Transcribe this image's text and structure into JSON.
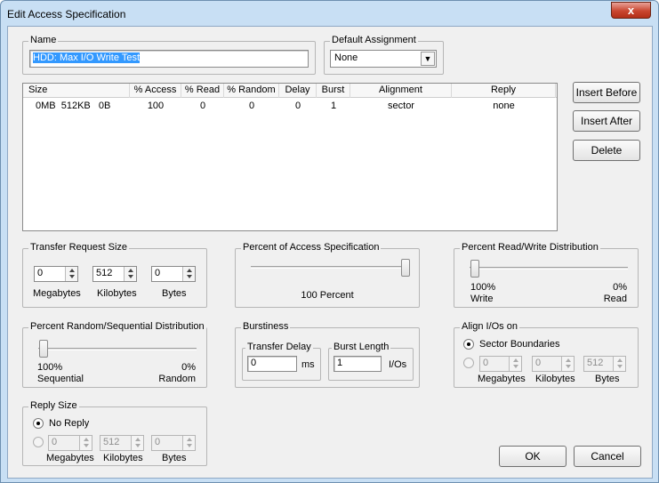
{
  "window": {
    "title": "Edit Access Specification",
    "close_symbol": "x"
  },
  "name_group": {
    "label": "Name",
    "value": "HDD: Max I/O Write Test"
  },
  "default_assignment": {
    "label": "Default Assignment",
    "value": "None"
  },
  "list": {
    "columns": [
      "Size",
      "% Access",
      "% Read",
      "% Random",
      "Delay",
      "Burst",
      "Alignment",
      "Reply"
    ],
    "rows": [
      {
        "size": "0MB  512KB   0B",
        "access": "100",
        "read": "0",
        "random": "0",
        "delay": "0",
        "burst": "1",
        "alignment": "sector",
        "reply": "none"
      }
    ]
  },
  "buttons": {
    "insert_before": "Insert Before",
    "insert_after": "Insert After",
    "delete": "Delete",
    "ok": "OK",
    "cancel": "Cancel"
  },
  "transfer_request": {
    "label": "Transfer Request Size",
    "megabytes": "0",
    "kilobytes": "512",
    "bytes": "0",
    "mb_label": "Megabytes",
    "kb_label": "Kilobytes",
    "b_label": "Bytes"
  },
  "percent_access": {
    "label": "Percent of Access Specification",
    "value_text": "100 Percent",
    "level": 1.0
  },
  "read_write": {
    "label": "Percent Read/Write Distribution",
    "left_pct": "100%",
    "left_name": "Write",
    "right_pct": "0%",
    "right_name": "Read",
    "level": 0.0
  },
  "random_seq": {
    "label": "Percent Random/Sequential Distribution",
    "left_pct": "100%",
    "left_name": "Sequential",
    "right_pct": "0%",
    "right_name": "Random",
    "level": 0.0
  },
  "burstiness": {
    "label": "Burstiness",
    "transfer_delay_label": "Transfer Delay",
    "transfer_delay": "0",
    "ms": "ms",
    "burst_length_label": "Burst Length",
    "burst_length": "1",
    "ios": "I/Os"
  },
  "align": {
    "label": "Align I/Os on",
    "sector_label": "Sector Boundaries",
    "mb": "0",
    "kb": "0",
    "b": "512",
    "mb_label": "Megabytes",
    "kb_label": "Kilobytes",
    "b_label": "Bytes"
  },
  "reply": {
    "label": "Reply Size",
    "no_reply_label": "No Reply",
    "mb": "0",
    "kb": "512",
    "b": "0",
    "mb_label": "Megabytes",
    "kb_label": "Kilobytes",
    "b_label": "Bytes"
  }
}
